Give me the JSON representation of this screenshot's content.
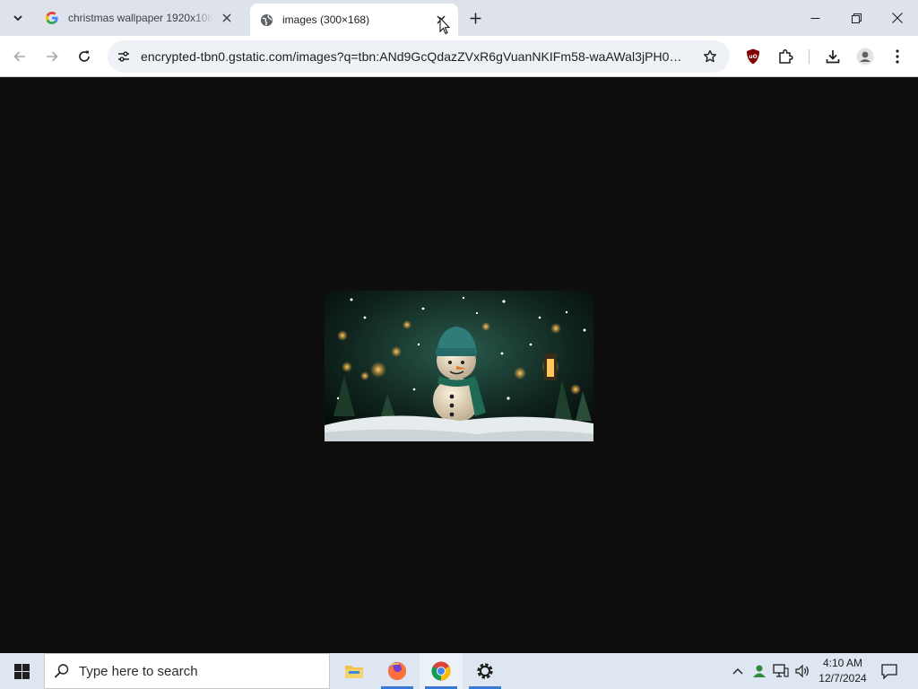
{
  "browser": {
    "tabs": [
      {
        "title": "christmas wallpaper 1920x1080",
        "favicon": "google-g-icon",
        "active": false
      },
      {
        "title": "images (300×168)",
        "favicon": "globe-icon",
        "active": true
      }
    ],
    "address_bar": {
      "url": "encrypted-tbn0.gstatic.com/images?q=tbn:ANd9GcQdazZVxR6gVuanNKIFm58-waAWal3jPH029A..."
    },
    "extensions": [
      "ublock-origin-icon",
      "puzzle-piece-icon"
    ],
    "colors": {
      "tabstrip": "#dee3eb",
      "omnibox": "#eef1f6",
      "page_bg": "#0e0e0e"
    }
  },
  "page": {
    "image_alt": "images (300×168)",
    "image_icon": "snowman-christmas-image"
  },
  "taskbar": {
    "search_placeholder": "Type here to search",
    "apps": [
      "file-explorer-icon",
      "firefox-icon",
      "chrome-icon",
      "settings-icon"
    ],
    "clock": {
      "time": "4:10 AM",
      "date": "12/7/2024"
    }
  }
}
